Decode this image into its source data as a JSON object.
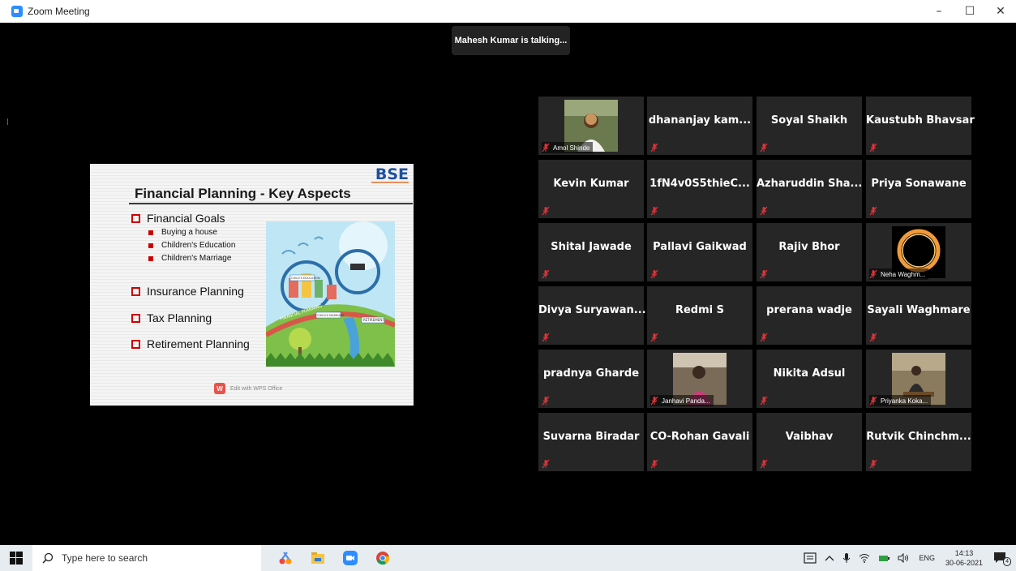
{
  "window": {
    "title": "Zoom Meeting",
    "controls": {
      "minimize": "–",
      "maximize": "☐",
      "close": "✕"
    }
  },
  "meeting": {
    "talking_indicator": "Mahesh Kumar is talking..."
  },
  "shared_slide": {
    "title": "Financial Planning - Key Aspects",
    "logo_text": "BSE",
    "bullets": [
      {
        "label": "Financial Goals",
        "sub": [
          "Buying a house",
          "Children's Education",
          "Children's Marriage"
        ]
      },
      {
        "label": "Insurance Planning",
        "sub": []
      },
      {
        "label": "Tax Planning",
        "sub": []
      },
      {
        "label": "Retirement Planning",
        "sub": []
      }
    ],
    "illustration_labels": [
      "FINANCIAL PLANNING",
      "CHILD'S EDUCATION",
      "CHILD'S MARRIAGE",
      "RETIREMENT"
    ],
    "wps_badge": "Edit with WPS Office",
    "wps_icon": "W"
  },
  "participants": [
    {
      "name": "Amol Shinde",
      "video": true
    },
    {
      "name": "dhananjay kam...",
      "video": false
    },
    {
      "name": "Soyal Shaikh",
      "video": false
    },
    {
      "name": "Kaustubh Bhavsar",
      "video": false
    },
    {
      "name": "Kevin Kumar",
      "video": false
    },
    {
      "name": "1fN4v0S5thieC...",
      "video": false
    },
    {
      "name": "Azharuddin Sha...",
      "video": false
    },
    {
      "name": "Priya Sonawane",
      "video": false
    },
    {
      "name": "Shital Jawade",
      "video": false
    },
    {
      "name": "Pallavi Gaikwad",
      "video": false
    },
    {
      "name": "Rajiv Bhor",
      "video": false
    },
    {
      "name": "Neha Waghm...",
      "video": true
    },
    {
      "name": "Divya Suryawan...",
      "video": false
    },
    {
      "name": "Redmi S",
      "video": false
    },
    {
      "name": "prerana wadje",
      "video": false
    },
    {
      "name": "Sayali Waghmare",
      "video": false
    },
    {
      "name": "pradnya Gharde",
      "video": false
    },
    {
      "name": "Janhavi Panda...",
      "video": true
    },
    {
      "name": "Nikita Adsul",
      "video": false
    },
    {
      "name": "Priyanka Koka...",
      "video": true
    },
    {
      "name": "Suvarna Biradar",
      "video": false
    },
    {
      "name": "CO-Rohan Gavali",
      "video": false
    },
    {
      "name": "Vaibhav",
      "video": false
    },
    {
      "name": "Rutvik Chinchm...",
      "video": false
    }
  ],
  "taskbar": {
    "search_placeholder": "Type here to search",
    "language": "ENG",
    "time": "14:13",
    "date": "30-06-2021",
    "notification_count": "4"
  },
  "colors": {
    "zoom_blue": "#2d8cff",
    "tile_bg": "#262626",
    "mute_red": "#e0343a",
    "slide_red": "#cc0000"
  }
}
